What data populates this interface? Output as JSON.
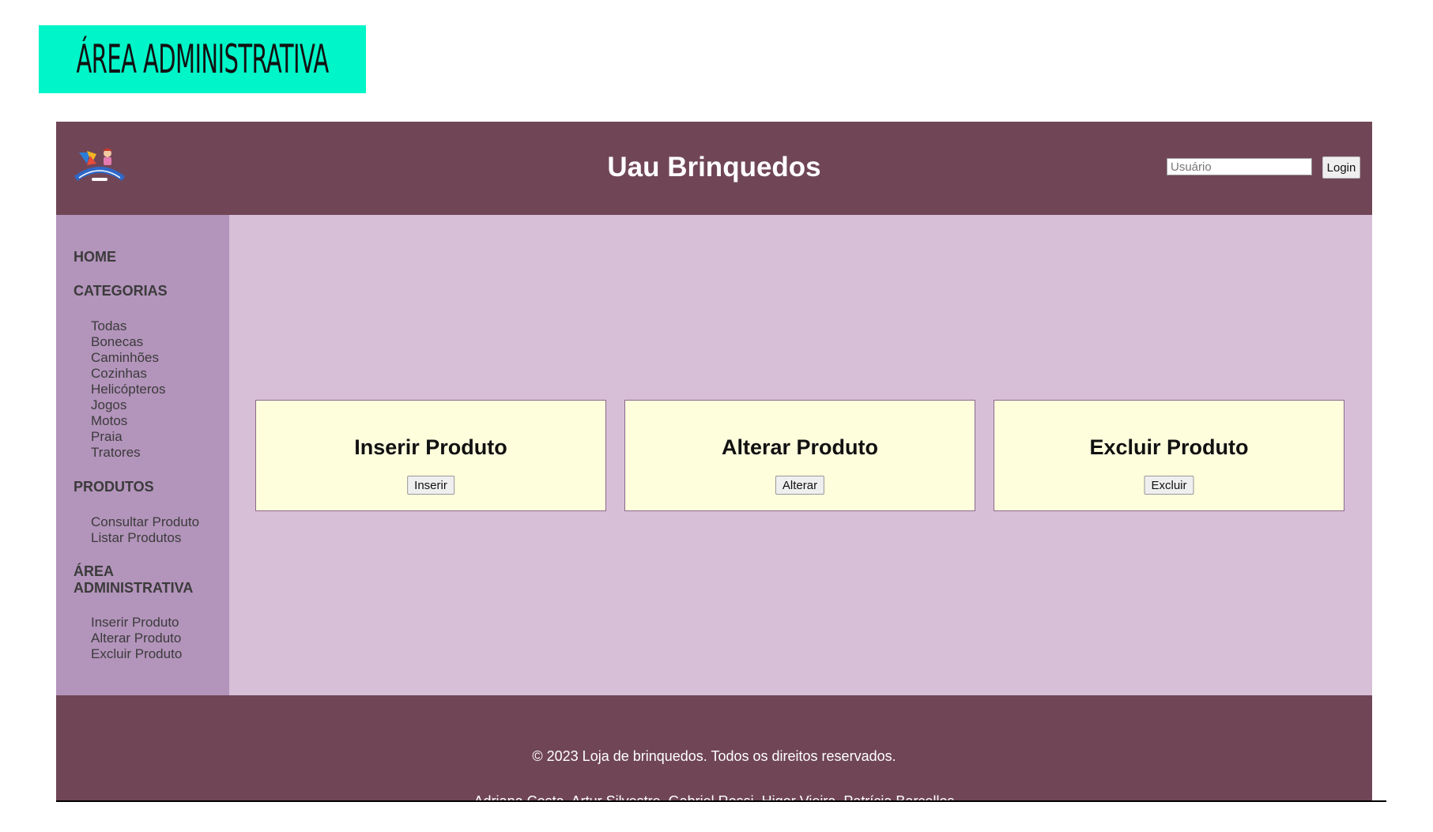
{
  "page_heading": "ÁREA ADMINISTRATIVA",
  "header": {
    "title": "Uau Brinquedos",
    "user_placeholder": "Usuário",
    "login_label": "Login"
  },
  "sidebar": {
    "home": "HOME",
    "categories_heading": "CATEGORIAS",
    "categories": [
      "Todas",
      "Bonecas",
      "Caminhões",
      "Cozinhas",
      "Helicópteros",
      "Jogos",
      "Motos",
      "Praia",
      "Tratores"
    ],
    "products_heading": "PRODUTOS",
    "products": [
      "Consultar Produto",
      "Listar Produtos"
    ],
    "admin_heading_line1": "ÁREA",
    "admin_heading_line2": "ADMINISTRATIVA",
    "admin": [
      "Inserir Produto",
      "Alterar Produto",
      "Excluir Produto"
    ]
  },
  "cards": [
    {
      "title": "Inserir Produto",
      "button": "Inserir"
    },
    {
      "title": "Alterar Produto",
      "button": "Alterar"
    },
    {
      "title": "Excluir Produto",
      "button": "Excluir"
    }
  ],
  "footer": {
    "copyright": "© 2023 Loja de brinquedos. Todos os direitos reservados.",
    "authors": "Adriana Costa, Artur Silvestre, Gabriel Rossi, Higor Vieira, Patrícia Barcellos"
  },
  "colors": {
    "accent": "#00f5c8",
    "header": "#704657",
    "sidebar": "#b394bb",
    "main": "#d8bfd8",
    "card": "#fefedd"
  },
  "icons": {
    "logo": "toy-store-logo-icon"
  }
}
